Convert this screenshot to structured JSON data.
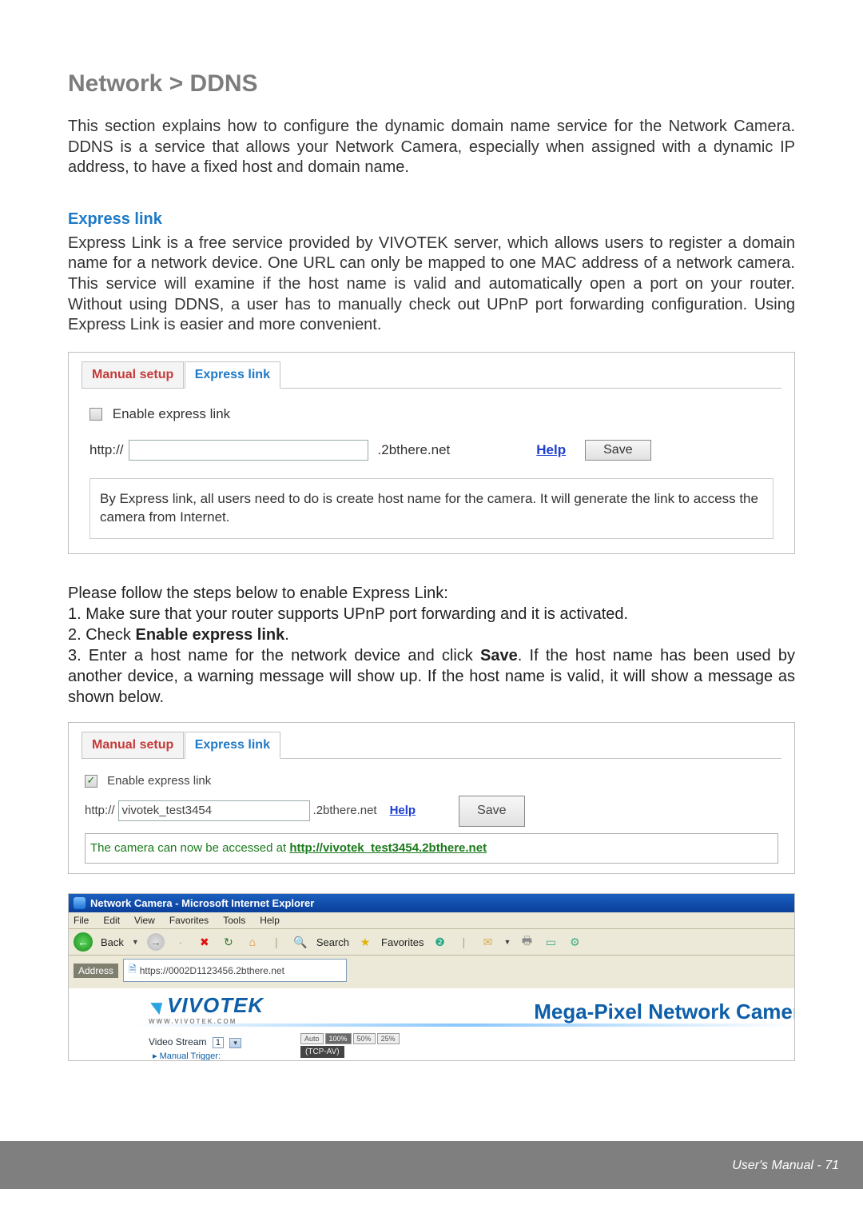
{
  "header": {
    "brand": "VIVOTEK"
  },
  "title": "Network > DDNS",
  "intro": "This section explains how to configure the dynamic domain name service for the Network Camera. DDNS is a service that allows your Network Camera, especially when assigned with a dynamic IP address, to have a fixed host and domain name.",
  "section1": {
    "heading": "Express link",
    "body": "Express Link is a free service provided by VIVOTEK server, which allows users to register a domain name for a network device. One URL can only be mapped to one MAC address of a network camera. This service will examine if the host name is valid and automatically open a port on your router. Without using DDNS, a user has to manually check out UPnP port forwarding configuration. Using Express Link is easier and more convenient."
  },
  "fig1": {
    "tab1": "Manual setup",
    "tab2": "Express link",
    "checkbox": "Enable express link",
    "prefix": "http://",
    "suffix": ".2bthere.net",
    "help": "Help",
    "save": "Save",
    "hint": "By Express link, all users need to do is create host name for the camera. It will generate the link to access the camera from Internet."
  },
  "steps": {
    "intro": "Please follow the steps below to enable Express Link:",
    "s1": "1. Make sure that your router supports UPnP port forwarding and it is activated.",
    "s2a": "2. Check ",
    "s2b": "Enable express link",
    "s2c": ".",
    "s3a": "3. Enter a host name for the network device and click ",
    "s3b": "Save",
    "s3c": ". If the host name has been used by another device, a warning message will show up. If the host name is valid, it will show a message as shown below."
  },
  "fig2": {
    "checkmark": "✓",
    "hostvalue": "vivotek_test3454",
    "msg_a": "The camera can now be accessed at ",
    "msg_url": "http://vivotek_test3454.2bthere.net"
  },
  "ie": {
    "title": "Network Camera - Microsoft Internet Explorer",
    "menus": {
      "file": "File",
      "edit": "Edit",
      "view": "View",
      "fav": "Favorites",
      "tools": "Tools",
      "help": "Help"
    },
    "back": "Back",
    "search": "Search",
    "favorites": "Favorites",
    "addr_label": "Address",
    "url": "https://0002D1123456.2bthere.net",
    "logo": "VIVOTEK",
    "logosub": "WWW.VIVOTEK.COM",
    "heading": "Mega-Pixel Network Camer",
    "vs_lbl": "Video Stream",
    "vs_val": "1",
    "mt": "Manual Trigger:",
    "tcp": "(TCP-AV)",
    "zoom": {
      "auto": "Auto",
      "z100": "100%",
      "z50": "50%",
      "z25": "25%"
    }
  },
  "footer": {
    "text": "User's Manual - 71"
  }
}
